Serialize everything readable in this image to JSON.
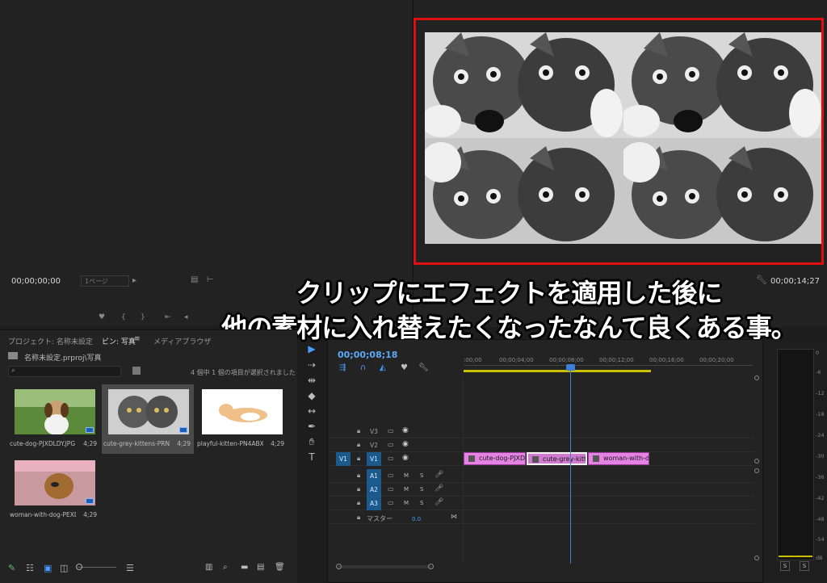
{
  "source_monitor": {
    "timecode": "00;00;00;00",
    "page_select": "1ページ"
  },
  "program_monitor": {
    "timecode": "00;00;14;27"
  },
  "caption": {
    "line1": "クリップにエフェクトを適用した後に",
    "line2": "他の素材に入れ替えたくなったなんて良くある事。"
  },
  "project_panel": {
    "tabs": [
      "プロジェクト: 名称未設定",
      "ビン: 写真",
      "メディアブラウザ"
    ],
    "bin_path": "名称未設定.prproj\\写真",
    "selection_status": "4 個中 1 個の項目が選択されました",
    "items": [
      {
        "name": "cute-dog-PJXDLDY.JPG",
        "duration": "4;29"
      },
      {
        "name": "cute-grey-kittens-PRNH...",
        "duration": "4;29"
      },
      {
        "name": "playful-kitten-PN4ABXC...",
        "duration": "4;29"
      },
      {
        "name": "woman-with-dog-PEXD...",
        "duration": "4;29"
      }
    ]
  },
  "timeline": {
    "timecode": "00;00;08;18",
    "ruler": [
      ":00;00",
      "00;00;04;00",
      "00;00;08;00",
      "00;00;12;00",
      "00;00;16;00",
      "00;00;20;00"
    ],
    "tracks": {
      "v3": "V3",
      "v2": "V2",
      "v1": "V1",
      "v1_src": "V1",
      "a1": "A1",
      "a2": "A2",
      "a3": "A3",
      "m": "M",
      "s": "S",
      "master": "マスター",
      "master_value": "0.0"
    },
    "clips": [
      "cute-dog-PJXDLD",
      "cute-grey-kitten",
      "woman-with-dog"
    ]
  },
  "meter": {
    "db": [
      "0",
      "-6",
      "-12",
      "-18",
      "-24",
      "-30",
      "-36",
      "-42",
      "-48",
      "-54",
      "dB"
    ],
    "solo": "S"
  },
  "tools": [
    "selection-icon",
    "track-select-icon",
    "ripple-edit-icon",
    "razor-icon",
    "slip-icon",
    "pen-icon",
    "hand-icon",
    "type-icon"
  ]
}
